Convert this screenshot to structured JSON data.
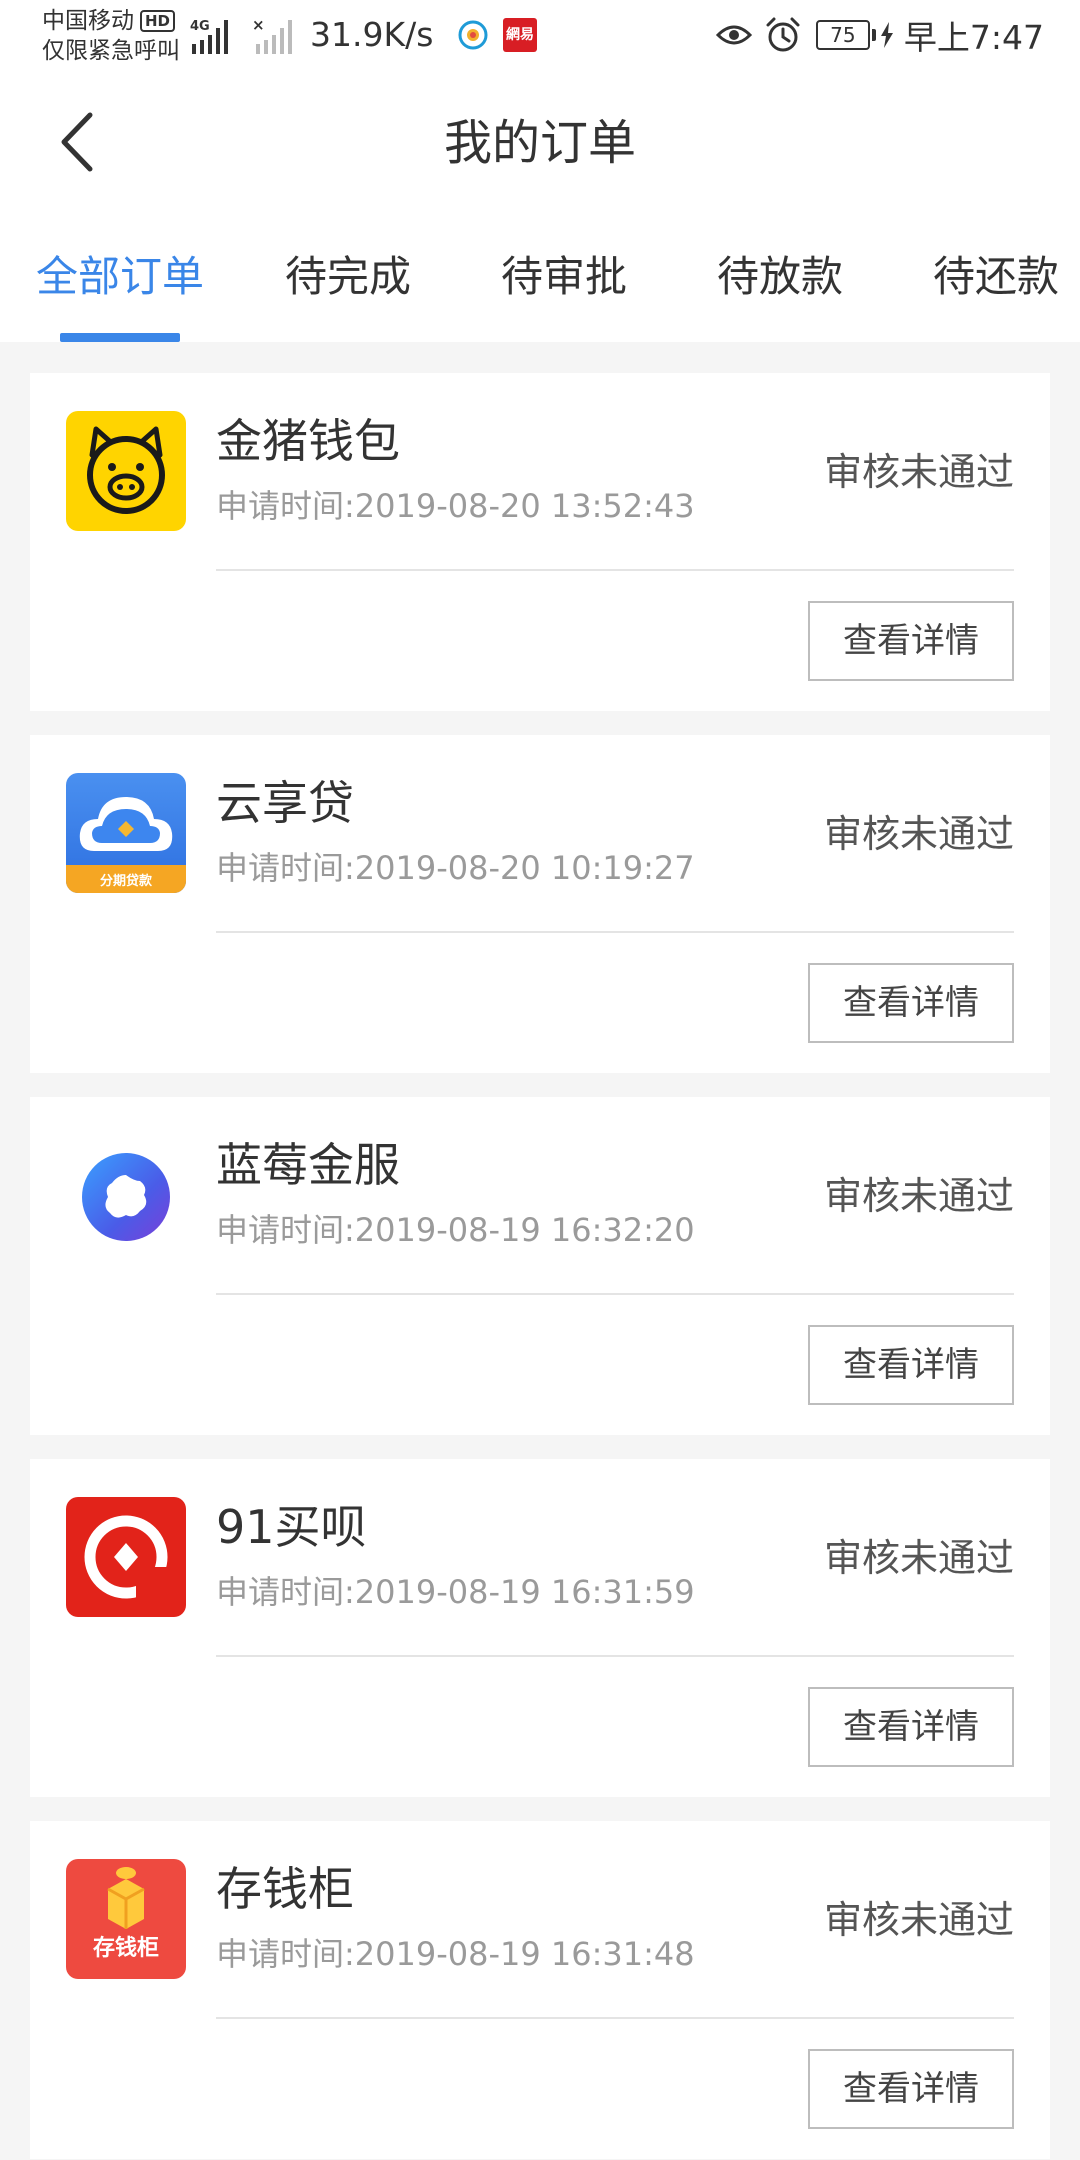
{
  "status_bar": {
    "carrier": "中国移动",
    "hd_badge": "HD",
    "emergency": "仅限紧急呼叫",
    "network_type": "4G",
    "speed": "31.9K/s",
    "app_badge": "網易",
    "battery": "75",
    "time": "早上7:47"
  },
  "nav": {
    "title": "我的订单"
  },
  "tabs": [
    {
      "label": "全部订单",
      "active": true
    },
    {
      "label": "待完成",
      "active": false
    },
    {
      "label": "待审批",
      "active": false
    },
    {
      "label": "待放款",
      "active": false
    },
    {
      "label": "待还款",
      "active": false
    }
  ],
  "orders": [
    {
      "name": "金猪钱包",
      "time": "申请时间:2019-08-20 13:52:43",
      "status": "审核未通过",
      "button": "查看详情",
      "logo_icon": "golden-pig-icon"
    },
    {
      "name": "云享贷",
      "time": "申请时间:2019-08-20 10:19:27",
      "status": "审核未通过",
      "button": "查看详情",
      "logo_icon": "cloud-loan-icon",
      "logo_text": "分期贷款"
    },
    {
      "name": "蓝莓金服",
      "time": "申请时间:2019-08-19 16:32:20",
      "status": "审核未通过",
      "button": "查看详情",
      "logo_icon": "blueberry-icon"
    },
    {
      "name": "91买呗",
      "time": "申请时间:2019-08-19 16:31:59",
      "status": "审核未通过",
      "button": "查看详情",
      "logo_icon": "ring-diamond-icon"
    },
    {
      "name": "存钱柜",
      "time": "申请时间:2019-08-19 16:31:48",
      "status": "审核未通过",
      "button": "查看详情",
      "logo_icon": "gift-box-icon",
      "logo_text": "存钱柜"
    }
  ],
  "colors": {
    "accent": "#3a86e8",
    "background": "#f5f5f5",
    "card": "#ffffff"
  }
}
